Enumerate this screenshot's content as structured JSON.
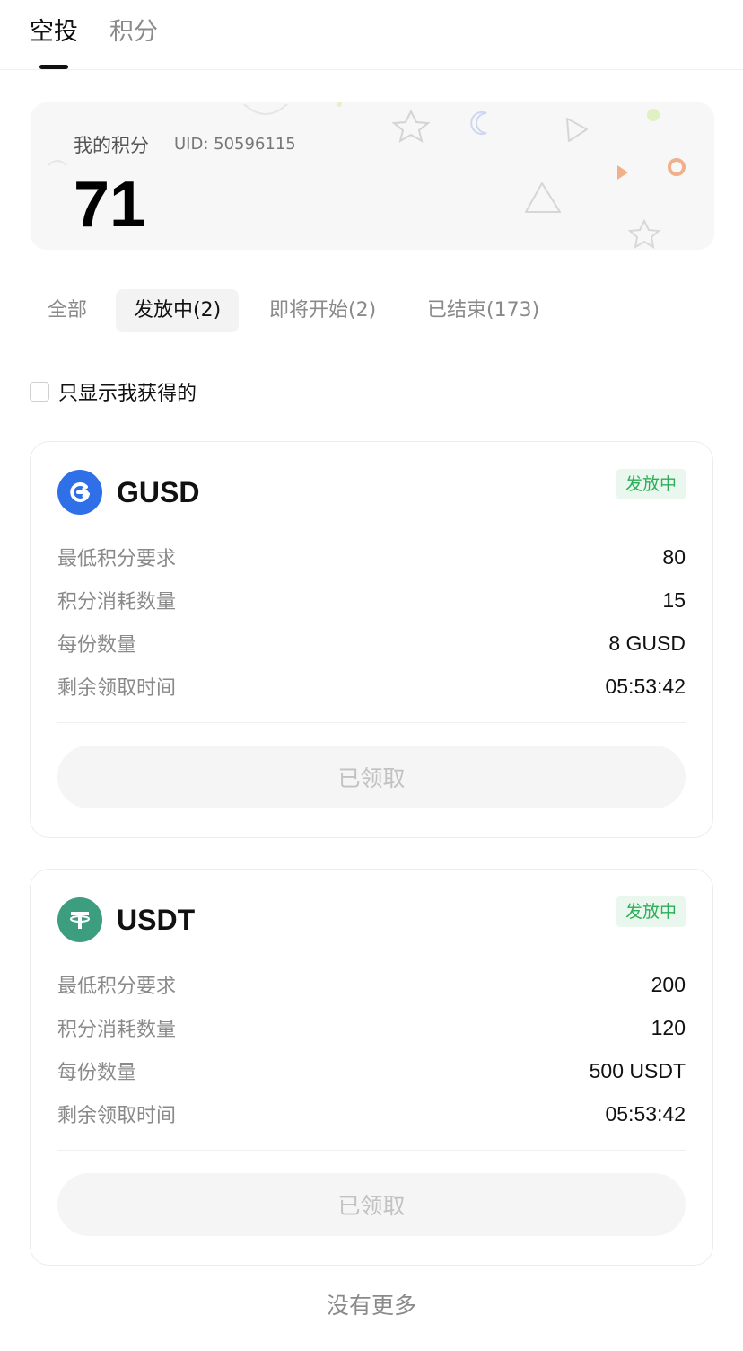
{
  "top_tabs": [
    {
      "label": "空投",
      "active": true
    },
    {
      "label": "积分",
      "active": false
    }
  ],
  "points_card": {
    "label": "我的积分",
    "uid": "UID: 50596115",
    "value": "71"
  },
  "filter_tabs": [
    {
      "label": "全部",
      "active": false
    },
    {
      "label": "发放中(2)",
      "active": true
    },
    {
      "label": "即将开始(2)",
      "active": false
    },
    {
      "label": "已结束(173)",
      "active": false
    }
  ],
  "only_mine": {
    "label": "只显示我获得的",
    "checked": false
  },
  "airdrops": [
    {
      "coin": "GUSD",
      "icon": "gusd-coin-icon",
      "icon_color": "#2f6fe8",
      "status": "发放中",
      "rows": [
        {
          "label": "最低积分要求",
          "value": "80"
        },
        {
          "label": "积分消耗数量",
          "value": "15"
        },
        {
          "label": "每份数量",
          "value": "8 GUSD"
        },
        {
          "label": "剩余领取时间",
          "value": "05:53:42"
        }
      ],
      "button": "已领取"
    },
    {
      "coin": "USDT",
      "icon": "tether-coin-icon",
      "icon_color": "#3d9e7f",
      "status": "发放中",
      "rows": [
        {
          "label": "最低积分要求",
          "value": "200"
        },
        {
          "label": "积分消耗数量",
          "value": "120"
        },
        {
          "label": "每份数量",
          "value": "500 USDT"
        },
        {
          "label": "剩余领取时间",
          "value": "05:53:42"
        }
      ],
      "button": "已领取"
    }
  ],
  "footer": "没有更多",
  "colors": {
    "status_green": "#2fae5a",
    "status_bg": "#eaf7ee",
    "muted_text": "#8a8a8a",
    "disabled_button_bg": "#f5f5f6"
  }
}
